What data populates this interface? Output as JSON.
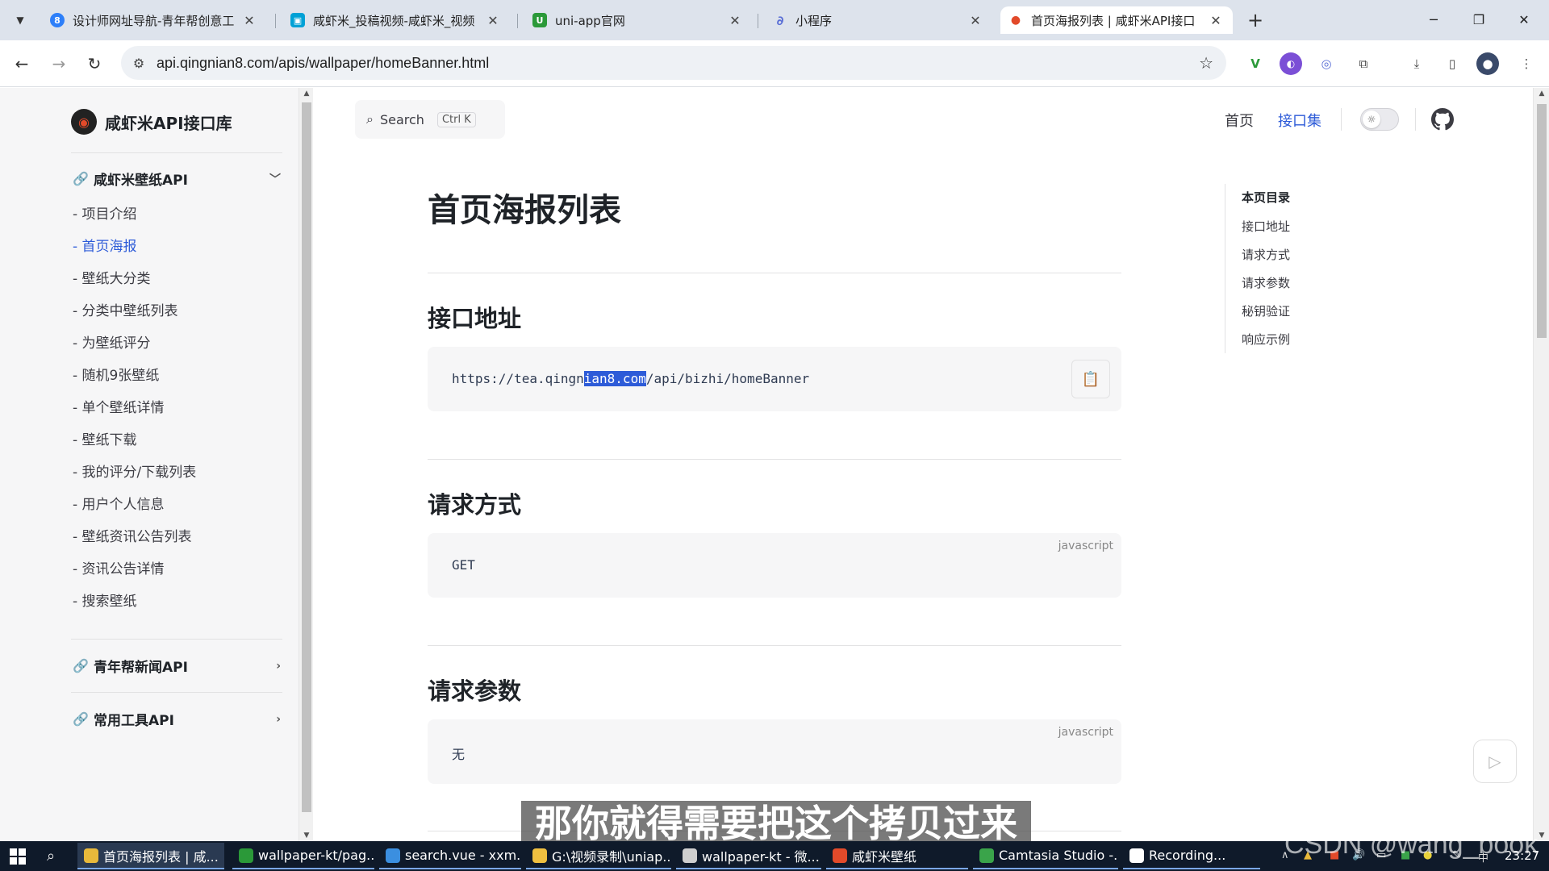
{
  "browser": {
    "tabs": [
      {
        "title": "设计师网址导航-青年帮创意工",
        "favicon_color": "#2d7ff9",
        "favicon_glyph": "8"
      },
      {
        "title": "咸虾米_投稿视频-咸虾米_视频",
        "favicon_color": "#00a1d6",
        "favicon_glyph": "▣"
      },
      {
        "title": "uni-app官网",
        "favicon_color": "#2b9939",
        "favicon_glyph": "U"
      },
      {
        "title": "小程序",
        "favicon_color": "#5a6fd6",
        "favicon_glyph": "∂"
      },
      {
        "title": "首页海报列表 | 咸虾米API接口",
        "favicon_color": "#e24a2a",
        "favicon_glyph": "●"
      }
    ],
    "active_tab": 4,
    "url": "api.qingnian8.com/apis/wallpaper/homeBanner.html"
  },
  "sidebar": {
    "brand": "咸虾米API接口库",
    "groups": [
      {
        "title": "咸虾米壁纸API",
        "expanded": true,
        "items": [
          "- 项目介绍",
          "- 首页海报",
          "- 壁纸大分类",
          "- 分类中壁纸列表",
          "- 为壁纸评分",
          "- 随机9张壁纸",
          "- 单个壁纸详情",
          "- 壁纸下载",
          "- 我的评分/下载列表",
          "- 用户个人信息",
          "- 壁纸资讯公告列表",
          "- 资讯公告详情",
          "- 搜索壁纸"
        ],
        "active_item": 1
      },
      {
        "title": "青年帮新闻API",
        "expanded": false
      },
      {
        "title": "常用工具API",
        "expanded": false
      }
    ]
  },
  "header": {
    "search_label": "Search",
    "search_shortcut": "Ctrl K",
    "nav": [
      "首页",
      "接口集"
    ],
    "active_nav": 1
  },
  "content": {
    "title": "首页海报列表",
    "sections": [
      {
        "heading": "接口地址",
        "code_before": "https://tea.qingn",
        "code_selected": "ian8.com",
        "code_after": "/api/bizhi/homeBanner"
      },
      {
        "heading": "请求方式",
        "lang": "javascript",
        "code": "GET"
      },
      {
        "heading": "请求参数",
        "lang": "javascript",
        "code": "无"
      }
    ]
  },
  "toc": {
    "title": "本页目录",
    "items": [
      "接口地址",
      "请求方式",
      "请求参数",
      "秘钥验证",
      "响应示例"
    ]
  },
  "overlay": {
    "subtitle": "那你就得需要把这个拷贝过来",
    "watermark": "CSDN @wang_book"
  },
  "taskbar": {
    "tasks": [
      {
        "label": "首页海报列表 | 咸...",
        "icon_color": "#e8b93b"
      },
      {
        "label": "wallpaper-kt/pag...",
        "icon_color": "#2b9939"
      },
      {
        "label": "search.vue - xxm...",
        "icon_color": "#3b8fe0"
      },
      {
        "label": "G:\\视频录制\\uniap...",
        "icon_color": "#f0c040"
      },
      {
        "label": "wallpaper-kt - 微...",
        "icon_color": "#cfcfcf"
      },
      {
        "label": "咸虾米壁纸",
        "icon_color": "#e24a2a"
      },
      {
        "label": "Camtasia Studio -...",
        "icon_color": "#3aa44a"
      },
      {
        "label": "Recording...",
        "icon_color": "#ffffff"
      }
    ],
    "active_task": 0,
    "clock": "23:27"
  }
}
